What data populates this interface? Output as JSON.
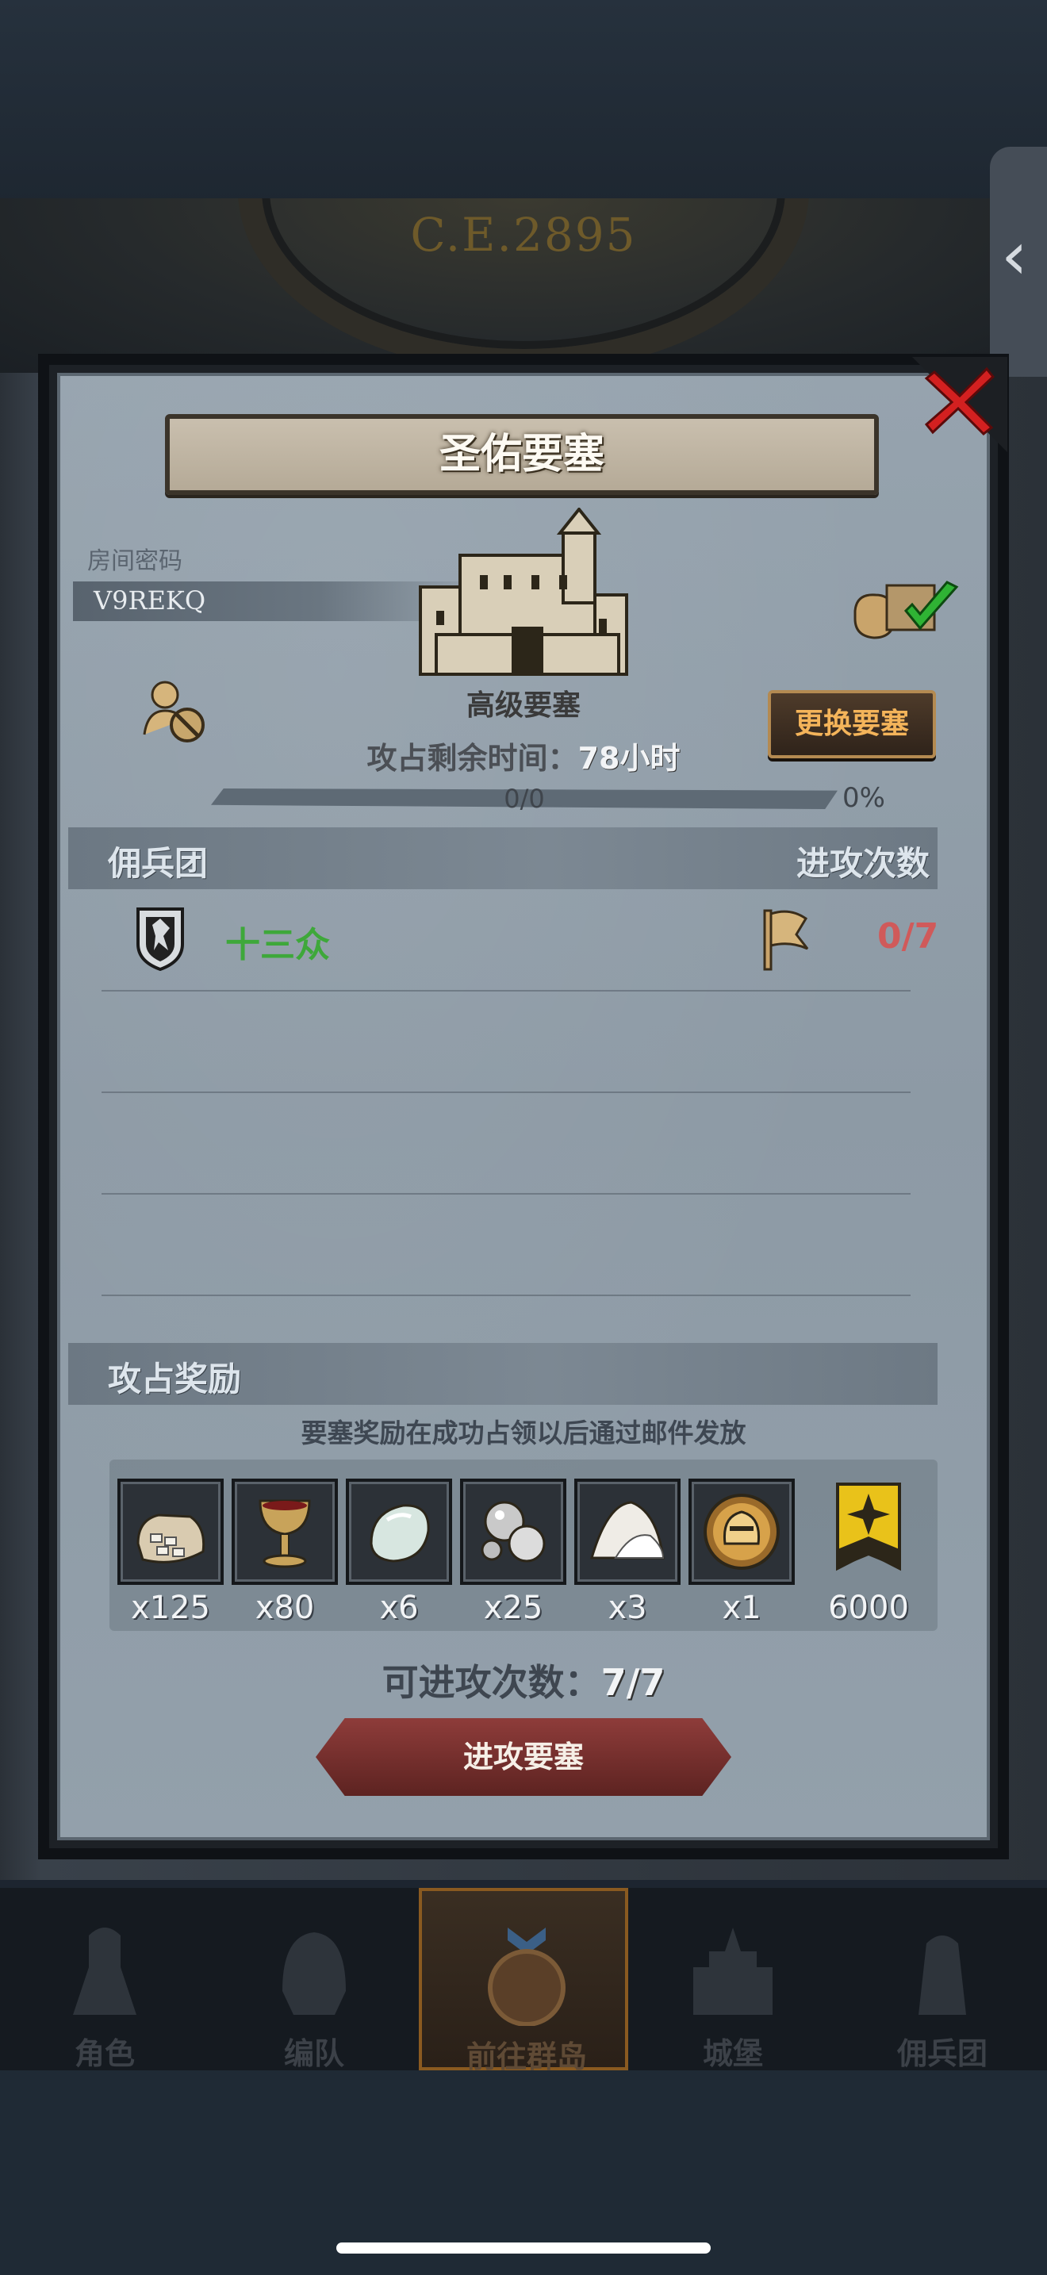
{
  "era": "C.E.2895",
  "fortress": {
    "title": "圣佑要塞",
    "room_label": "房间密码",
    "room_code": "V9REKQ",
    "level": "高级要塞",
    "time_label": "攻占剩余时间：",
    "time_value": "78小时",
    "change_button": "更换要塞",
    "progress_text": "0/0",
    "progress_percent": "0%",
    "progress_value": 0
  },
  "mercenary_section": {
    "title": "佣兵团",
    "attack_count_header": "进攻次数",
    "guilds": [
      {
        "name": "十三众",
        "attacks": "0/7"
      }
    ]
  },
  "rewards": {
    "title": "攻占奖励",
    "note": "要塞奖励在成功占领以后通过邮件发放",
    "items": [
      {
        "icon": "coin-sack-icon",
        "qty": "x125"
      },
      {
        "icon": "goblet-icon",
        "qty": "x80"
      },
      {
        "icon": "white-stone-icon",
        "qty": "x6"
      },
      {
        "icon": "silver-orbs-icon",
        "qty": "x25"
      },
      {
        "icon": "salt-pile-icon",
        "qty": "x3"
      },
      {
        "icon": "knight-helmet-icon",
        "qty": "x1"
      },
      {
        "icon": "rank-banner-icon",
        "qty": "6000"
      }
    ],
    "attempts_label": "可进攻次数：",
    "attempts_value": "7/7",
    "attack_button": "进攻要塞"
  },
  "nav": {
    "items": [
      {
        "label": "角色",
        "icon": "knight-icon"
      },
      {
        "label": "编队",
        "icon": "helmet-icon"
      },
      {
        "label": "前往群岛",
        "icon": "islands-icon"
      },
      {
        "label": "城堡",
        "icon": "castle-icon"
      },
      {
        "label": "佣兵团",
        "icon": "mercenary-icon"
      }
    ]
  },
  "colors": {
    "guild_name": "#3ea83a",
    "attack_count": "#d05a5a",
    "change_button_text": "#f4b45a",
    "attack_button": "#8e3c3a"
  }
}
